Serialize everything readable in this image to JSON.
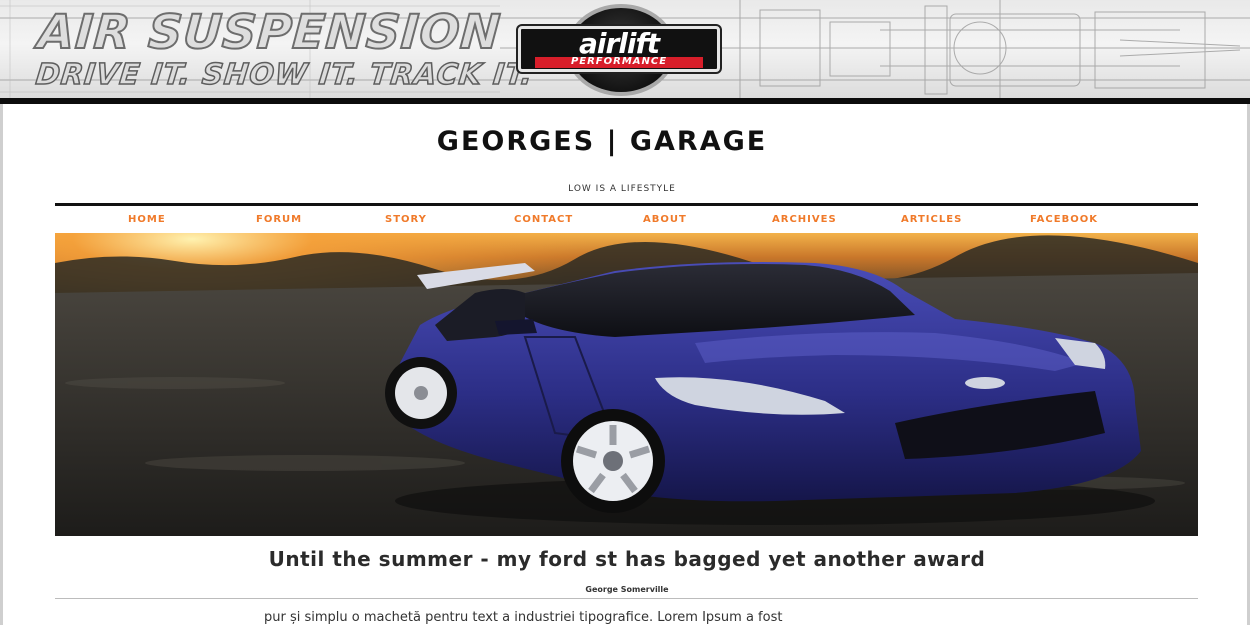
{
  "banner": {
    "headline": "AIR SUSPENSION",
    "tagline": "DRIVE IT. SHOW IT. TRACK IT.",
    "logo_brand": "airlift",
    "logo_sub": "PERFORMANCE"
  },
  "site": {
    "title": "GEORGES | GARAGE",
    "tagline": "LOW IS A LIFESTYLE"
  },
  "nav": {
    "items": [
      {
        "label": "HOME"
      },
      {
        "label": "FORUM"
      },
      {
        "label": "STORY"
      },
      {
        "label": "CONTACT"
      },
      {
        "label": "ABOUT"
      },
      {
        "label": "ARCHIVES"
      },
      {
        "label": "ARTICLES"
      },
      {
        "label": "FACEBOOK"
      }
    ]
  },
  "post": {
    "title": "Until the summer - my ford st has bagged yet another award",
    "author": "George Somerville",
    "body": "pur și simplu o machetă pentru text a industriei tipografice. Lorem Ipsum a fost"
  },
  "colors": {
    "nav_accent": "#f07a2a",
    "logo_red": "#d81e2a",
    "car_blue": "#2c2e86",
    "rule": "#111111"
  }
}
